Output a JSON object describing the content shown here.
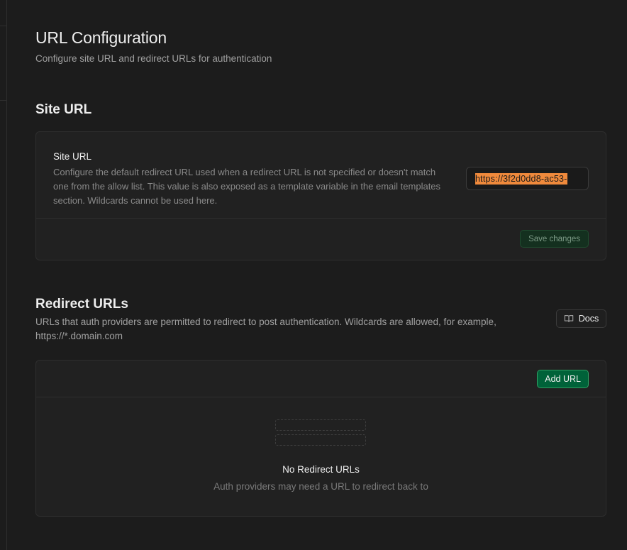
{
  "page": {
    "title": "URL Configuration",
    "subtitle": "Configure site URL and redirect URLs for authentication"
  },
  "site_url": {
    "section_title": "Site URL",
    "field_label": "Site URL",
    "description": "Configure the default redirect URL used when a redirect URL is not specified or doesn't match one from the allow list. This value is also exposed as a template variable in the email templates section. Wildcards cannot be used here.",
    "input_value": "https://3f2d0dd8-ac53-",
    "save_label": "Save changes"
  },
  "redirect_urls": {
    "section_title": "Redirect URLs",
    "description": "URLs that auth providers are permitted to redirect to post authentication. Wildcards are allowed, for example, https://*.domain.com",
    "docs_label": "Docs",
    "docs_icon": "book-icon",
    "add_label": "Add URL",
    "empty_title": "No Redirect URLs",
    "empty_description": "Auth providers may need a URL to redirect back to"
  },
  "colors": {
    "background": "#1c1c1c",
    "card": "#212121",
    "brand_green": "#006239",
    "selection_highlight": "#f08a3c"
  }
}
